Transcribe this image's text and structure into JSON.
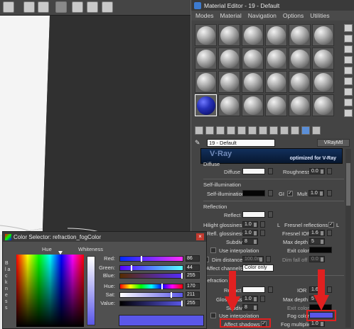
{
  "toolbar": {
    "icons": [
      "viewport-icon",
      "curve-editor-icon",
      "schematic-icon",
      "material-editor-icon",
      "render-setup-icon",
      "rendered-frame-icon",
      "render-icon"
    ]
  },
  "material_editor": {
    "title": "Material Editor - 19 - Default",
    "menu": [
      "Modes",
      "Material",
      "Navigation",
      "Options",
      "Utilities"
    ],
    "slots": 24,
    "active_slot_index": 18,
    "material_name": "19 - Default",
    "material_type": "VRayMtl",
    "banner_text": "optimized for V-Ray",
    "banner_logo": "V·Ray",
    "diffuse": {
      "header": "Diffuse",
      "diffuse_label": "Diffuse",
      "roughness_label": "Roughness",
      "roughness_value": "0.0"
    },
    "self_illum": {
      "header": "Self-illumination",
      "label": "Self-illumination",
      "gi_label": "GI",
      "mult_label": "Mult",
      "mult_value": "1.0"
    },
    "reflection": {
      "header": "Reflection",
      "reflect_label": "Reflect",
      "hilight_label": "Hilight glossiness",
      "hilight_value": "1.0",
      "l_label": "L",
      "fresnel_label": "Fresnel reflections",
      "refl_gloss_label": "Refl. glossiness",
      "refl_gloss_value": "1.0",
      "fresnel_ior_label": "Fresnel IOR",
      "fresnel_ior_value": "1.6",
      "subdivs_label": "Subdivs",
      "subdivs_value": "8",
      "maxdepth_label": "Max depth",
      "maxdepth_value": "5",
      "interp_label": "Use interpolation",
      "exit_label": "Exit color",
      "dimdist_label": "Dim distance",
      "dimdist_value": "100.0m",
      "dimfall_label": "Dim fall off",
      "dimfall_value": "0.0",
      "affectch_label": "Affect channels",
      "affectch_value": "Color only"
    },
    "refraction": {
      "header": "Refraction",
      "refract_label": "Refract",
      "ior_label": "IOR",
      "ior_value": "1.6",
      "glossiness_label": "Glossiness",
      "glossiness_value": "1.0",
      "maxdepth_label": "Max depth",
      "maxdepth_value": "5",
      "subdivs_label": "Subdivs",
      "subdivs_value": "8",
      "exit_label": "Exit color",
      "interp_label": "Use interpolation",
      "fogcolor_label": "Fog color",
      "affectshadows_label": "Affect shadows",
      "fogmult_label": "Fog multiplier",
      "fogmult_value": "1.0"
    }
  },
  "color_selector": {
    "title": "Color Selector: refraction_fogColor",
    "hue_label": "Hue",
    "whiteness_label": "Whiteness",
    "blackness_label": "B l a c k n e s s",
    "channels": [
      {
        "label": "Red:",
        "value": "86"
      },
      {
        "label": "Green:",
        "value": "44"
      },
      {
        "label": "Blue:",
        "value": "255"
      },
      {
        "label": "Hue:",
        "value": "170"
      },
      {
        "label": "Sat:",
        "value": "211"
      },
      {
        "label": "Value:",
        "value": "255"
      }
    ],
    "channel_levels": [
      0.34,
      0.17,
      1.0,
      0.67,
      0.83,
      1.0
    ]
  },
  "colors": {
    "fog": "#5a57e8",
    "highlight": "#e02020",
    "active_slot": "#2630b8"
  }
}
